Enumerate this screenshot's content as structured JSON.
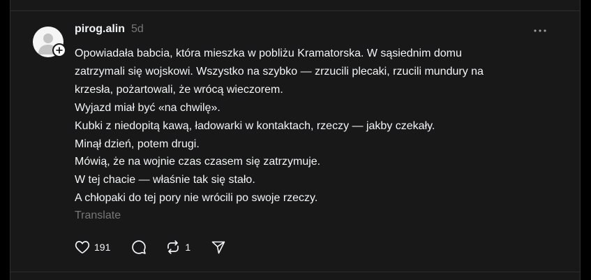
{
  "post": {
    "username": "pirog.alin",
    "timestamp": "5d",
    "lines": [
      "Opowiadała babcia, która mieszka w pobliżu Kramatorska. W sąsiednim domu",
      "zatrzymali się wojskowi. Wszystko na szybko — zrzucili plecaki, rzucili mundury na",
      "krzesła, pożartowali, że wrócą wieczorem.",
      "Wyjazd miał być «na chwilę».",
      "Kubki z niedopitą kawą, ładowarki w kontaktach, rzeczy — jakby czekały.",
      "Minął dzień, potem drugi.",
      "Mówią, że na wojnie czas czasem się zatrzymuje.",
      "W tej chacie — właśnie tak się stało.",
      "A chłopaki do tej pory nie wrócili po swoje rzeczy."
    ],
    "translate_label": "Translate",
    "likes": "191",
    "reposts": "1"
  },
  "icons": {
    "avatar": "default-avatar-icon",
    "follow": "plus-icon",
    "more": "more-horizontal-icon",
    "like": "heart-icon",
    "reply": "comment-icon",
    "repost": "repost-icon",
    "share": "send-icon"
  },
  "colors": {
    "background": "#000000",
    "panel": "#181818",
    "text": "#f3f5f7",
    "secondary_text": "#777777",
    "border": "#2d2d2d"
  }
}
